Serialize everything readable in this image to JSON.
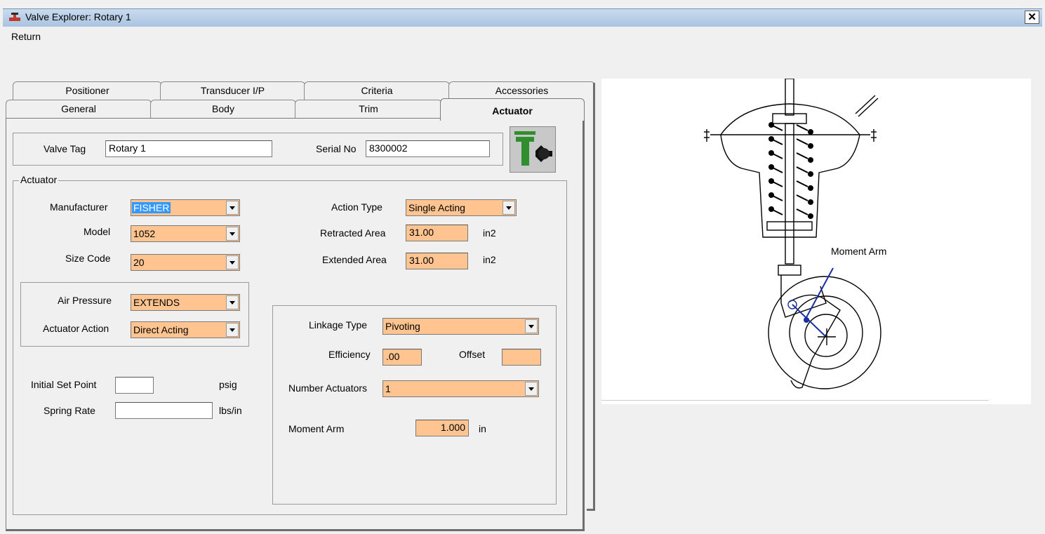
{
  "window": {
    "title": "Valve Explorer: Rotary 1",
    "close_glyph": "✕"
  },
  "menu": {
    "return_label": "Return"
  },
  "tabs_back": [
    {
      "label": "Positioner",
      "accel": "P"
    },
    {
      "label": "Transducer I/P"
    },
    {
      "label": "Criteria"
    },
    {
      "label": "Accessories"
    }
  ],
  "tabs_front": [
    {
      "label": "General"
    },
    {
      "label": "Body"
    },
    {
      "label": "Trim"
    },
    {
      "label": "Actuator"
    }
  ],
  "header": {
    "valve_tag_label": "Valve Tag",
    "valve_tag_value": "Rotary 1",
    "serial_label": "Serial No",
    "serial_value": "8300002"
  },
  "actuator": {
    "group_title": "Actuator",
    "manufacturer_label": "Manufacturer",
    "manufacturer_value": "FISHER",
    "model_label": "Model",
    "model_value": "1052",
    "size_code_label": "Size Code",
    "size_code_value": "20",
    "action_type_label": "Action Type",
    "action_type_value": "Single Acting",
    "retracted_area_label": "Retracted Area",
    "retracted_area_value": "31.00",
    "retracted_area_unit": "in2",
    "extended_area_label": "Extended Area",
    "extended_area_value": "31.00",
    "extended_area_unit": "in2",
    "air_pressure_label": "Air Pressure",
    "air_pressure_value": "EXTENDS",
    "actuator_action_label": "Actuator Action",
    "actuator_action_value": "Direct Acting",
    "initial_set_point_label": "Initial Set Point",
    "initial_set_point_value": "",
    "initial_set_point_unit": "psig",
    "spring_rate_label": "Spring Rate",
    "spring_rate_value": "",
    "spring_rate_unit": "lbs/in"
  },
  "linkage": {
    "linkage_type_label": "Linkage Type",
    "linkage_type_value": "Pivoting",
    "efficiency_label": "Efficiency",
    "efficiency_value": ".00",
    "offset_label": "Offset",
    "offset_value": "",
    "number_actuators_label": "Number Actuators",
    "number_actuators_value": "1",
    "moment_arm_label": "Moment Arm",
    "moment_arm_value": "1.000",
    "moment_arm_unit": "in"
  },
  "diagram": {
    "moment_arm_label": "Moment Arm"
  },
  "colors": {
    "field_fill": "#ffc48f",
    "diagram_accent": "#1a2fa0",
    "title_bar": "#b6cde7"
  }
}
